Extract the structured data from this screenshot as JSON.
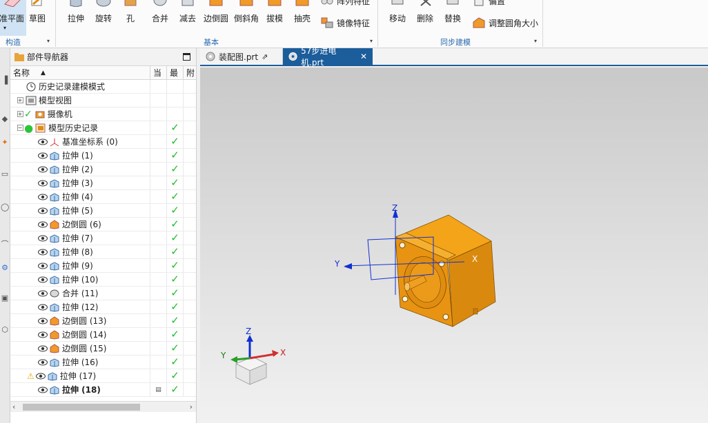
{
  "ribbon": {
    "construct_group": {
      "label": "构造",
      "buttons": [
        {
          "label": "准平面",
          "icon": "datum-plane-icon"
        },
        {
          "label": "草图",
          "icon": "sketch-icon"
        }
      ]
    },
    "basic_group": {
      "label": "基本",
      "buttons": [
        {
          "label": "拉伸",
          "icon": "extrude-icon"
        },
        {
          "label": "旋转",
          "icon": "revolve-icon"
        },
        {
          "label": "孔",
          "icon": "hole-icon"
        },
        {
          "label": "合并",
          "icon": "unite-icon"
        },
        {
          "label": "减去",
          "icon": "subtract-icon"
        },
        {
          "label": "边倒圆",
          "icon": "edge-blend-icon"
        },
        {
          "label": "倒斜角",
          "icon": "chamfer-icon"
        },
        {
          "label": "拔模",
          "icon": "draft-icon"
        },
        {
          "label": "抽壳",
          "icon": "shell-icon"
        }
      ],
      "small_buttons": [
        {
          "label": "阵列特征",
          "icon": "pattern-feature-icon"
        },
        {
          "label": "镜像特征",
          "icon": "mirror-feature-icon"
        }
      ]
    },
    "sync_group": {
      "label": "同步建模",
      "buttons": [
        {
          "label": "移动",
          "icon": "move-face-icon"
        },
        {
          "label": "删除",
          "icon": "delete-face-icon"
        },
        {
          "label": "替换",
          "icon": "replace-face-icon"
        }
      ],
      "small_buttons": [
        {
          "label": "偏置",
          "icon": "offset-face-icon"
        },
        {
          "label": "调整圆角大小",
          "icon": "resize-blend-icon"
        }
      ]
    }
  },
  "navigator": {
    "title": "部件导航器",
    "columns": {
      "name": "名称",
      "current": "当",
      "latest": "最",
      "attached": "附"
    },
    "rows": [
      {
        "label": "历史记录建模模式",
        "icon": "clock-icon",
        "indent": 0,
        "expander": "",
        "status": "",
        "check": false,
        "eye": false
      },
      {
        "label": "模型视图",
        "icon": "model-views-icon",
        "indent": 0,
        "expander": "+",
        "status": "",
        "check": false,
        "eye": false
      },
      {
        "label": "摄像机",
        "icon": "camera-icon",
        "indent": 0,
        "expander": "+",
        "status": "✓",
        "check": false,
        "eye": false
      },
      {
        "label": "模型历史记录",
        "icon": "model-history-icon",
        "indent": 0,
        "expander": "−",
        "status": "●",
        "check": true,
        "eye": false
      },
      {
        "label": "基准坐标系 (0)",
        "icon": "datum-csys-icon",
        "indent": 1,
        "expander": "",
        "status": "",
        "check": true,
        "eye": true
      },
      {
        "label": "拉伸 (1)",
        "icon": "extrude-feature-icon",
        "indent": 1,
        "expander": "",
        "status": "",
        "check": true,
        "eye": true
      },
      {
        "label": "拉伸 (2)",
        "icon": "extrude-feature-icon",
        "indent": 1,
        "expander": "",
        "status": "",
        "check": true,
        "eye": true
      },
      {
        "label": "拉伸 (3)",
        "icon": "extrude-feature-icon",
        "indent": 1,
        "expander": "",
        "status": "",
        "check": true,
        "eye": true
      },
      {
        "label": "拉伸 (4)",
        "icon": "extrude-feature-icon",
        "indent": 1,
        "expander": "",
        "status": "",
        "check": true,
        "eye": true
      },
      {
        "label": "拉伸 (5)",
        "icon": "extrude-feature-icon",
        "indent": 1,
        "expander": "",
        "status": "",
        "check": true,
        "eye": true
      },
      {
        "label": "边倒圆 (6)",
        "icon": "edge-blend-feature-icon",
        "indent": 1,
        "expander": "",
        "status": "",
        "check": true,
        "eye": true
      },
      {
        "label": "拉伸 (7)",
        "icon": "extrude-feature-icon",
        "indent": 1,
        "expander": "",
        "status": "",
        "check": true,
        "eye": true
      },
      {
        "label": "拉伸 (8)",
        "icon": "extrude-feature-icon",
        "indent": 1,
        "expander": "",
        "status": "",
        "check": true,
        "eye": true
      },
      {
        "label": "拉伸 (9)",
        "icon": "extrude-feature-icon",
        "indent": 1,
        "expander": "",
        "status": "",
        "check": true,
        "eye": true
      },
      {
        "label": "拉伸 (10)",
        "icon": "extrude-feature-icon",
        "indent": 1,
        "expander": "",
        "status": "",
        "check": true,
        "eye": true
      },
      {
        "label": "合并 (11)",
        "icon": "unite-feature-icon",
        "indent": 1,
        "expander": "",
        "status": "",
        "check": true,
        "eye": true
      },
      {
        "label": "拉伸 (12)",
        "icon": "extrude-feature-icon",
        "indent": 1,
        "expander": "",
        "status": "",
        "check": true,
        "eye": true
      },
      {
        "label": "边倒圆 (13)",
        "icon": "edge-blend-feature-icon",
        "indent": 1,
        "expander": "",
        "status": "",
        "check": true,
        "eye": true
      },
      {
        "label": "边倒圆 (14)",
        "icon": "edge-blend-feature-icon",
        "indent": 1,
        "expander": "",
        "status": "",
        "check": true,
        "eye": true
      },
      {
        "label": "边倒圆 (15)",
        "icon": "edge-blend-feature-icon",
        "indent": 1,
        "expander": "",
        "status": "",
        "check": true,
        "eye": true
      },
      {
        "label": "拉伸 (16)",
        "icon": "extrude-feature-icon",
        "indent": 1,
        "expander": "",
        "status": "",
        "check": true,
        "eye": true
      },
      {
        "label": "拉伸 (17)",
        "icon": "extrude-feature-icon",
        "indent": 1,
        "expander": "",
        "status": "⚠",
        "check": true,
        "eye": true
      },
      {
        "label": "拉伸 (18)",
        "icon": "extrude-feature-icon",
        "indent": 1,
        "expander": "",
        "status": "",
        "check": true,
        "eye": true,
        "bold": true,
        "current": true
      }
    ]
  },
  "tabs": [
    {
      "label": "装配图.prt",
      "active": false
    },
    {
      "label": "57步进电机.prt",
      "active": true
    }
  ],
  "viewport": {
    "csys_labels": {
      "z": "Z",
      "y": "Y",
      "x": "X"
    },
    "triad_labels": {
      "z": "Z",
      "y": "Y",
      "x": "X"
    },
    "colors": {
      "part": "#f0a020",
      "csys": "#1030d0",
      "bg_top": "#c9c9c9",
      "bg_bottom": "#f1f1f1"
    }
  }
}
